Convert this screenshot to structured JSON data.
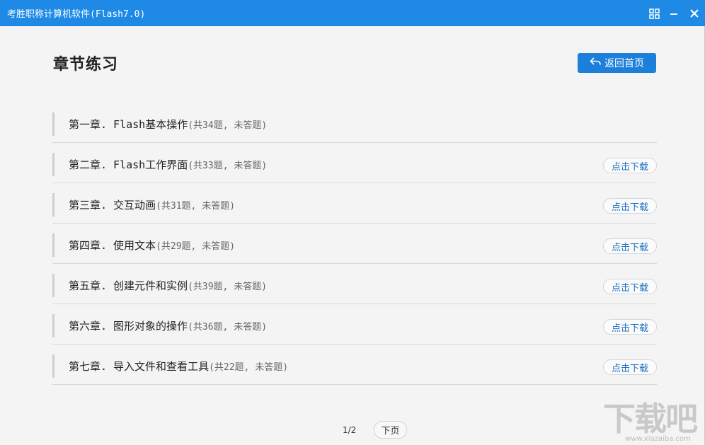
{
  "window": {
    "title": "考胜职称计算机软件(Flash7.0)",
    "icons": [
      "grid-icon",
      "minimize-icon",
      "close-icon"
    ]
  },
  "page": {
    "title": "章节练习",
    "home_button": "返回首页"
  },
  "chapters": [
    {
      "label": "第一章. Flash基本操作",
      "meta": "(共34题, 未答题)",
      "download": ""
    },
    {
      "label": "第二章. Flash工作界面",
      "meta": "(共33题, 未答题)",
      "download": "点击下载"
    },
    {
      "label": "第三章. 交互动画",
      "meta": "(共31题, 未答题)",
      "download": "点击下载"
    },
    {
      "label": "第四章. 使用文本",
      "meta": "(共29题, 未答题)",
      "download": "点击下载"
    },
    {
      "label": "第五章. 创建元件和实例",
      "meta": "(共39题, 未答题)",
      "download": "点击下载"
    },
    {
      "label": "第六章. 图形对象的操作",
      "meta": "(共36题, 未答题)",
      "download": "点击下载"
    },
    {
      "label": "第七章. 导入文件和查看工具",
      "meta": "(共22题, 未答题)",
      "download": "点击下载"
    }
  ],
  "pagination": {
    "current": "1/2",
    "next_label": "下页"
  },
  "watermark": {
    "logo_text": "下载吧",
    "url": "www.xiazaiba.com"
  },
  "colors": {
    "titlebar": "#1f8ae6",
    "accent": "#1c7fd9",
    "link": "#1a6fc2"
  }
}
